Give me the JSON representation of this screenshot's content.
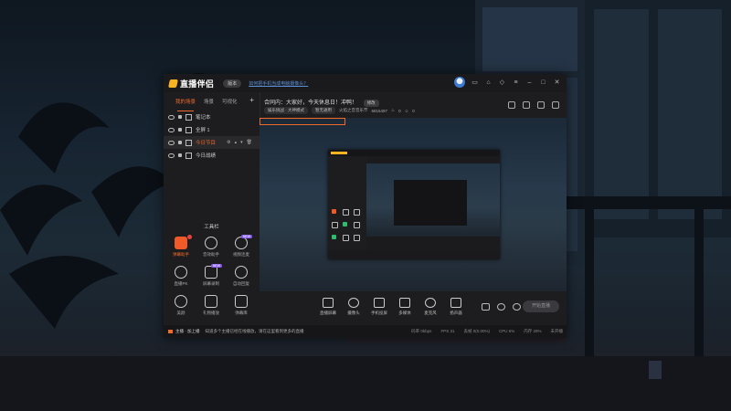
{
  "app": {
    "name": "直播伴侣",
    "version_label": "版本",
    "notice": "如何把手机当成电脑摄像头？",
    "accent": "#f06a2a"
  },
  "sidebar": {
    "tabs": [
      {
        "label": "我的场景",
        "active": true
      },
      {
        "label": "场景",
        "active": false
      },
      {
        "label": "可视化",
        "active": false
      }
    ],
    "add_icon": "plus-icon",
    "scenes": [
      {
        "label": "笔记本",
        "selected": false
      },
      {
        "label": "全屏 1",
        "selected": false
      },
      {
        "label": "今日节目",
        "selected": true
      },
      {
        "label": "今日战绩",
        "selected": false
      }
    ],
    "tools_title": "工具栏",
    "tools": [
      {
        "label": "弹幕助手",
        "active": true,
        "badge": "red"
      },
      {
        "label": "音效助手",
        "active": false,
        "badge": ""
      },
      {
        "label": "视频连麦",
        "active": false,
        "badge": "NEW"
      },
      {
        "label": "直播PK",
        "active": false,
        "badge": ""
      },
      {
        "label": "屏幕录制",
        "active": false,
        "badge": "NEW"
      },
      {
        "label": "自动回复",
        "active": false,
        "badge": ""
      },
      {
        "label": "美颜",
        "active": false,
        "badge": ""
      },
      {
        "label": "礼物播放",
        "active": false,
        "badge": ""
      },
      {
        "label": "弹幕库",
        "active": false,
        "badge": ""
      }
    ]
  },
  "topinfo": {
    "title": "合同内：大家好，今天休息日！冲鸭！",
    "edit_label": "修改",
    "tags": [
      "娱乐挑战 · 大神模式",
      "暂无通用"
    ],
    "stats": [
      "火焰之音音乐节",
      "6815497",
      "0",
      "0"
    ]
  },
  "bottombar": {
    "buttons": [
      {
        "label": "直播屏幕",
        "icon": "screen-share-icon"
      },
      {
        "label": "摄像头",
        "icon": "camera-icon"
      },
      {
        "label": "手机投屏",
        "icon": "phone-cast-icon"
      },
      {
        "label": "多媒体",
        "icon": "media-play-icon"
      },
      {
        "label": "麦克风",
        "icon": "microphone-icon"
      },
      {
        "label": "扬声器",
        "icon": "speaker-icon"
      }
    ],
    "start_label": "开始直播"
  },
  "statusbar": {
    "announcement": "主播 · 加上播",
    "message": "知道多个主播已经在线播放，请在这里看到更多的直播",
    "stats": [
      "码率 0kbps",
      "FPS 31",
      "丢帧 0(0.00%)",
      "CPU 6%",
      "内存 29%",
      "未开播"
    ]
  }
}
